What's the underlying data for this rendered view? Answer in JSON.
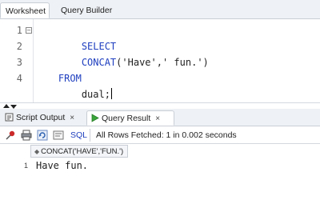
{
  "top_tabs": {
    "worksheet": "Worksheet",
    "query_builder": "Query Builder"
  },
  "editor": {
    "line_numbers": [
      "1",
      "2",
      "3",
      "4"
    ],
    "lines": {
      "l1": "SELECT",
      "l2_fn": "CONCAT",
      "l2_args": "('Have',' fun.')",
      "l3": "FROM",
      "l4": "dual;"
    }
  },
  "output_tabs": {
    "script_output": "Script Output",
    "query_result": "Query Result",
    "close_glyph": "×"
  },
  "toolbar": {
    "sql_label": "SQL",
    "status": "All Rows Fetched: 1 in 0.002 seconds"
  },
  "grid": {
    "columns": [
      "CONCAT('HAVE','FUN.')"
    ],
    "rows": [
      {
        "num": "1",
        "cells": [
          "Have fun."
        ]
      }
    ]
  },
  "colors": {
    "keyword": "#1f3fbf",
    "accent_green": "#3aa53a",
    "pin_red": "#cc2a2a"
  }
}
